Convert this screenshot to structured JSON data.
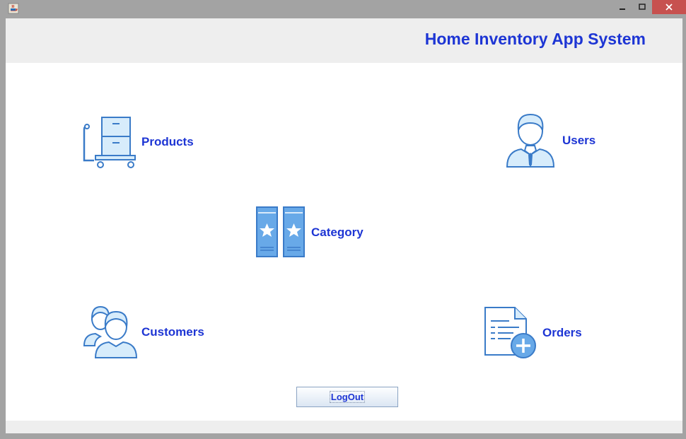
{
  "window": {
    "app_icon": "java-cup-icon",
    "controls": [
      "minimize-icon",
      "maximize-icon",
      "close-icon"
    ]
  },
  "header": {
    "title": "Home Inventory App System"
  },
  "tiles": {
    "products": {
      "label": "Products",
      "icon": "cart-boxes-icon"
    },
    "users": {
      "label": "Users",
      "icon": "user-icon"
    },
    "category": {
      "label": "Category",
      "icon": "star-folders-icon"
    },
    "customers": {
      "label": "Customers",
      "icon": "people-icon"
    },
    "orders": {
      "label": "Orders",
      "icon": "add-document-icon"
    }
  },
  "logout": {
    "label": "LogOut"
  },
  "colors": {
    "accent": "#1d35d4",
    "icon_fill": "#d7ecfb",
    "icon_stroke": "#3a7bc8",
    "header_bg": "#eeeeee",
    "close_button": "#c7514f"
  }
}
